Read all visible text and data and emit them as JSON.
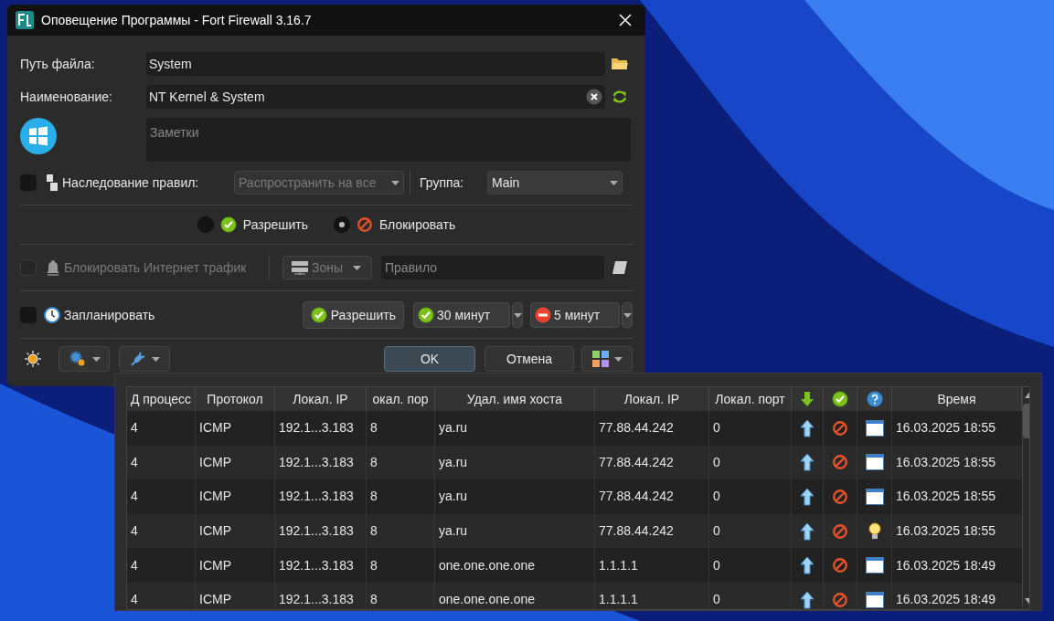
{
  "window": {
    "title": "Оповещение Программы - Fort Firewall 3.16.7"
  },
  "path_field": {
    "label": "Путь файла:",
    "value": "System"
  },
  "name_field": {
    "label": "Наименование:",
    "value": "NT Kernel & System"
  },
  "notes_field": {
    "placeholder": "Заметки"
  },
  "inheritance": {
    "checked": false,
    "label": "Наследование правил:",
    "combo": {
      "value": "Распространить на все",
      "disabled": true
    }
  },
  "group": {
    "label": "Группа:",
    "value": "Main"
  },
  "actions": [
    {
      "label": "Разрешить",
      "kind": "allow",
      "selected": false
    },
    {
      "label": "Блокировать",
      "kind": "block",
      "selected": true
    }
  ],
  "block_internet": {
    "checked": false,
    "disabled": true,
    "label": "Блокировать Интернет трафик",
    "zones": "Зоны",
    "rule_placeholder": "Правило"
  },
  "schedule": {
    "checked": false,
    "label": "Запланировать",
    "action_button": "Разрешить",
    "allow_time": "30 минут",
    "block_time": "5 минут"
  },
  "buttons": {
    "ok": "OK",
    "cancel": "Отмена"
  },
  "table": {
    "columns": [
      {
        "label": "Д процесс",
        "kind": "text"
      },
      {
        "label": "Протокол",
        "kind": "text"
      },
      {
        "label": "Локал. IP",
        "kind": "text"
      },
      {
        "label": "окал. пор",
        "kind": "text"
      },
      {
        "label": "Удал. имя хоста",
        "kind": "text"
      },
      {
        "label": "Локал. IP",
        "kind": "text"
      },
      {
        "label": "Локал. порт",
        "kind": "text"
      },
      {
        "kind": "direction"
      },
      {
        "kind": "action"
      },
      {
        "kind": "type"
      },
      {
        "label": "Время",
        "kind": "text"
      }
    ],
    "rows": [
      {
        "cells": [
          "4",
          "ICMP",
          "192.1...3.183",
          "8",
          "ya.ru",
          "77.88.44.242",
          "0"
        ],
        "outgoing": true,
        "blocked": true,
        "kind": "window",
        "time": "16.03.2025 18:55"
      },
      {
        "cells": [
          "4",
          "ICMP",
          "192.1...3.183",
          "8",
          "ya.ru",
          "77.88.44.242",
          "0"
        ],
        "outgoing": true,
        "blocked": true,
        "kind": "window",
        "time": "16.03.2025 18:55"
      },
      {
        "cells": [
          "4",
          "ICMP",
          "192.1...3.183",
          "8",
          "ya.ru",
          "77.88.44.242",
          "0"
        ],
        "outgoing": true,
        "blocked": true,
        "kind": "window",
        "time": "16.03.2025 18:55"
      },
      {
        "cells": [
          "4",
          "ICMP",
          "192.1...3.183",
          "8",
          "ya.ru",
          "77.88.44.242",
          "0"
        ],
        "outgoing": true,
        "blocked": true,
        "kind": "bulb",
        "time": "16.03.2025 18:55"
      },
      {
        "cells": [
          "4",
          "ICMP",
          "192.1...3.183",
          "8",
          "one.one.one.one",
          "1.1.1.1",
          "0"
        ],
        "outgoing": true,
        "blocked": true,
        "kind": "window",
        "time": "16.03.2025 18:49"
      },
      {
        "cells": [
          "4",
          "ICMP",
          "192.1...3.183",
          "8",
          "one.one.one.one",
          "1.1.1.1",
          "0"
        ],
        "outgoing": true,
        "blocked": true,
        "kind": "window",
        "time": "16.03.2025 18:49"
      }
    ]
  }
}
